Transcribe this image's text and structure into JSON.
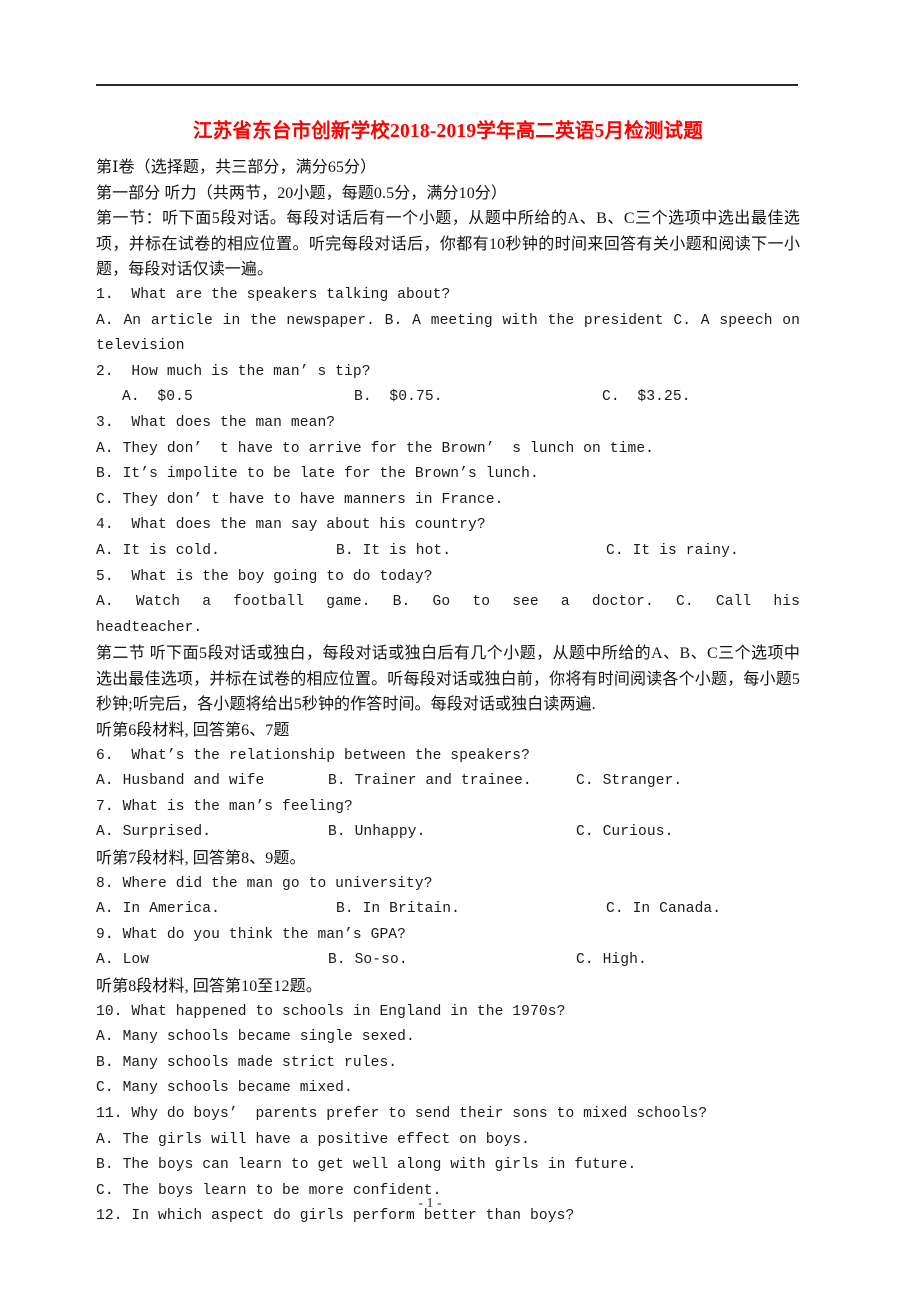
{
  "document": {
    "title": "江苏省东台市创新学校2018-2019学年高二英语5月检测试题",
    "page_number": "- 1 -"
  },
  "sections": {
    "paper_part": "第Ⅰ卷（选择题，共三部分，满分65分）",
    "part_one": "第一部分 听力（共两节，20小题，每题0.5分，满分10分）",
    "section_one_instructions": "第一节：听下面5段对话。每段对话后有一个小题，从题中所给的A、B、C三个选项中选出最佳选项，并标在试卷的相应位置。听完每段对话后，你都有10秒钟的时间来回答有关小题和阅读下一小题，每段对话仅读一遍。",
    "section_two_instructions": "第二节 听下面5段对话或独白，每段对话或独白后有几个小题，从题中所给的A、B、C三个选项中选出最佳选项，并标在试卷的相应位置。听每段对话或独白前，你将有时间阅读各个小题，每小题5秒钟;听完后，各小题将给出5秒钟的作答时间。每段对话或独白读两遍.",
    "material_6": "听第6段材料, 回答第6、7题",
    "material_7": "听第7段材料, 回答第8、9题。",
    "material_8": "听第8段材料, 回答第10至12题。"
  },
  "questions": [
    {
      "number": "1.",
      "stem": "1.  What are the speakers talking about?",
      "options_line": "A. An article in the newspaper. B. A meeting with the president   C. A speech on",
      "options_wrap": "television"
    },
    {
      "number": "2.",
      "stem": "2.  How much is the man’ s tip?",
      "option_a": "A.  $0.5",
      "option_b": "B.  $0.75.",
      "option_c": "C.  $3.25."
    },
    {
      "number": "3.",
      "stem": "3.  What does the man mean?",
      "option_a": "A. They don’  t have to arrive for the Brown’  s lunch on time.",
      "option_b": "B. It’s impolite to be late for the Brown’s lunch.",
      "option_c": "C. They don’ t have to have manners in France."
    },
    {
      "number": "4.",
      "stem": "4.  What does the man say about his country?",
      "option_a": "A. It is cold.",
      "option_b": "B. It is hot.",
      "option_c": "C. It is rainy."
    },
    {
      "number": "5.",
      "stem": "5.  What is the boy going to do today?",
      "options_line": "A. Watch a football game.      B. Go to see a doctor.        C.    Call    his",
      "options_wrap": "headteacher."
    },
    {
      "number": "6.",
      "stem": "6.  What’s the relationship between the speakers?",
      "option_a": "A. Husband and wife",
      "option_b": "B. Trainer and trainee.",
      "option_c": "C. Stranger."
    },
    {
      "number": "7.",
      "stem": "7. What is the man’s feeling?",
      "option_a": "A. Surprised.",
      "option_b": "B. Unhappy.",
      "option_c": "C. Curious."
    },
    {
      "number": "8.",
      "stem": "8. Where did the man go to university?",
      "option_a": "A. In America.",
      "option_b": "B. In Britain.",
      "option_c": "C. In Canada."
    },
    {
      "number": "9.",
      "stem": "9. What do you think the man’s GPA?",
      "option_a": "A. Low",
      "option_b": "B. So-so.",
      "option_c": "C. High."
    },
    {
      "number": "10.",
      "stem": "10. What happened to schools in England in the 1970s?",
      "option_a": "A. Many schools became single sexed.",
      "option_b": "B. Many schools made strict rules.",
      "option_c": "C. Many schools became mixed."
    },
    {
      "number": "11.",
      "stem": "11. Why do boys’  parents prefer to send their sons to mixed schools?",
      "option_a": "A. The girls will have a positive effect on boys.",
      "option_b": "B. The boys can learn to get well along with girls in future.",
      "option_c": "C. The boys learn to be more confident."
    },
    {
      "number": "12.",
      "stem": "12. In which aspect do girls perform better than boys?"
    }
  ]
}
